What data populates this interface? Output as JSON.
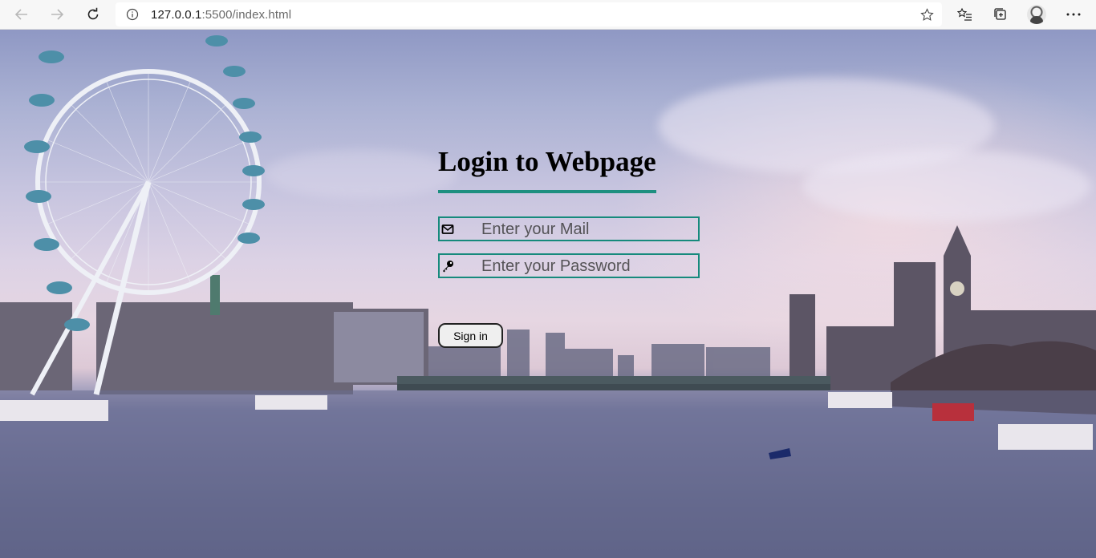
{
  "browser": {
    "url_host": "127.0.0.1",
    "url_path": ":5500/index.html"
  },
  "login": {
    "title": "Login to Webpage",
    "email_placeholder": "Enter your Mail",
    "password_placeholder": "Enter your Password",
    "signin_label": "Sign in"
  },
  "colors": {
    "accent": "#1d8f80",
    "field_border": "#168a7c"
  }
}
